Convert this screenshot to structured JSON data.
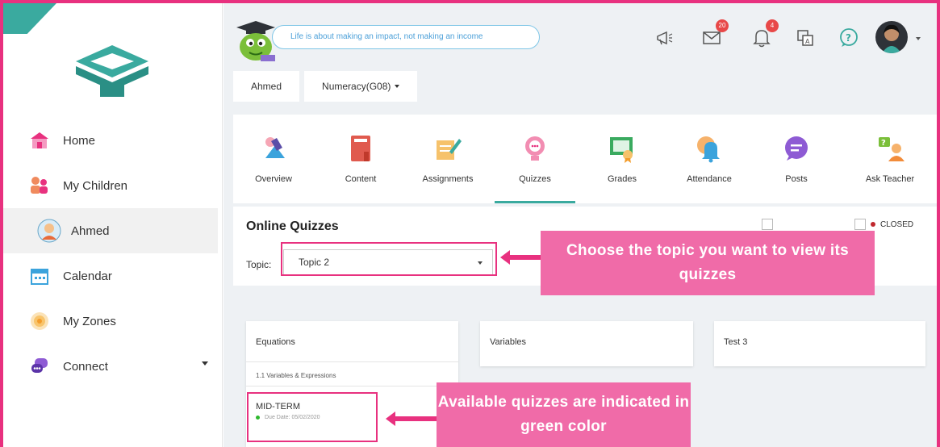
{
  "sidebar": {
    "nav": [
      {
        "label": "Home",
        "icon": "home-icon"
      },
      {
        "label": "My Children",
        "icon": "children-icon"
      },
      {
        "label": "Ahmed",
        "icon": "child-avatar-icon"
      },
      {
        "label": "Calendar",
        "icon": "calendar-icon"
      },
      {
        "label": "My Zones",
        "icon": "zones-icon"
      },
      {
        "label": "Connect",
        "icon": "connect-icon"
      }
    ]
  },
  "topbar": {
    "quote": "Life is about making an impact, not making an income",
    "messages_count": "20",
    "notifications_count": "4"
  },
  "breadcrumb": {
    "child": "Ahmed",
    "course": "Numeracy(G08)"
  },
  "tabs": [
    {
      "label": "Overview",
      "icon": "overview-icon"
    },
    {
      "label": "Content",
      "icon": "content-icon"
    },
    {
      "label": "Assignments",
      "icon": "assignments-icon"
    },
    {
      "label": "Quizzes",
      "icon": "quizzes-icon",
      "active": true
    },
    {
      "label": "Grades",
      "icon": "grades-icon"
    },
    {
      "label": "Attendance",
      "icon": "attendance-icon"
    },
    {
      "label": "Posts",
      "icon": "posts-icon"
    },
    {
      "label": "Ask Teacher",
      "icon": "ask-teacher-icon"
    }
  ],
  "quizzes": {
    "title": "Online Quizzes",
    "topic_label": "Topic:",
    "topic_value": "Topic 2",
    "legend_closed": "CLOSED",
    "cards": [
      {
        "title": "Equations",
        "subtitle": "1.1 Variables & Expressions",
        "quiz_name": "MID-TERM",
        "quiz_due": "Due Date: 05/02/2020"
      },
      {
        "title": "Variables"
      },
      {
        "title": "Test 3"
      }
    ]
  },
  "annotations": {
    "topic_callout": "Choose the topic you want to view its quizzes",
    "green_callout": "Available quizzes are indicated in green color"
  },
  "colors": {
    "accent_teal": "#3aaa9f",
    "highlight_pink": "#e8317f",
    "callout_pink": "#f06ba8",
    "available_green": "#2eb82e",
    "closed_red": "#c0282d"
  }
}
